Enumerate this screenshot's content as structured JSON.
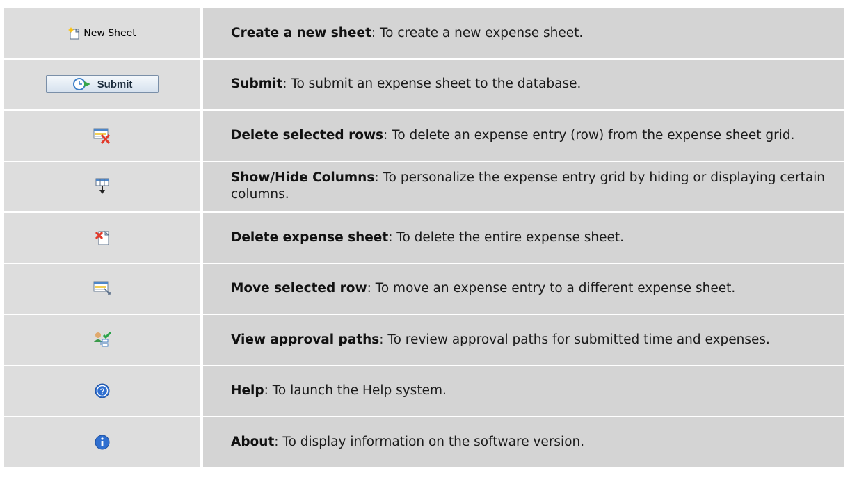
{
  "rows": [
    {
      "icon": "new-sheet-icon",
      "button_label": "New Sheet",
      "term": "Create a new sheet",
      "desc": ": To create a new expense sheet."
    },
    {
      "icon": "submit-clock-icon",
      "button_label": "Submit",
      "term": "Submit",
      "desc": ": To submit an expense sheet to the database."
    },
    {
      "icon": "delete-rows-icon",
      "term": "Delete selected rows",
      "desc": ": To delete an expense entry (row) from the expense sheet grid."
    },
    {
      "icon": "show-hide-columns-icon",
      "term": "Show/Hide Columns",
      "desc": ": To personalize the expense entry grid by hiding or displaying certain columns."
    },
    {
      "icon": "delete-sheet-icon",
      "term": "Delete expense sheet",
      "desc": ": To delete the entire expense sheet."
    },
    {
      "icon": "move-row-icon",
      "term": "Move selected row",
      "desc": ": To move an expense entry to a different expense sheet."
    },
    {
      "icon": "approval-paths-icon",
      "term": "View approval paths",
      "desc": ": To review approval paths for submitted time and expenses."
    },
    {
      "icon": "help-icon",
      "term": "Help",
      "desc": ": To launch the Help system."
    },
    {
      "icon": "info-icon",
      "term": "About",
      "desc": ": To display information on the software version."
    }
  ],
  "colors": {
    "row_bg": "#d4d4d4",
    "icon_cell_bg": "#dddddd",
    "separator": "#ffffff",
    "help_blue": "#2f6fd0"
  }
}
